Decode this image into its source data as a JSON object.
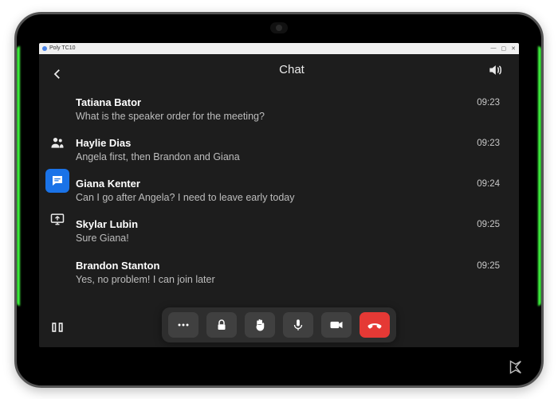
{
  "window": {
    "title": "Poly TC10"
  },
  "header": {
    "title": "Chat"
  },
  "sidebar": {
    "items": [
      {
        "name": "people-icon"
      },
      {
        "name": "chat-icon"
      },
      {
        "name": "share-screen-icon"
      }
    ],
    "bottom": {
      "name": "layout-icon"
    }
  },
  "messages": [
    {
      "name": "Tatiana Bator",
      "text": "What is the speaker order for the meeting?",
      "time": "09:23"
    },
    {
      "name": "Haylie Dias",
      "text": "Angela first, then Brandon and Giana",
      "time": "09:23"
    },
    {
      "name": "Giana Kenter",
      "text": "Can I go after Angela? I need to leave early today",
      "time": "09:24"
    },
    {
      "name": "Skylar Lubin",
      "text": "Sure Giana!",
      "time": "09:25"
    },
    {
      "name": "Brandon Stanton",
      "text": "Yes, no problem! I can join later",
      "time": "09:25"
    }
  ],
  "toolbar": {
    "buttons": [
      {
        "name": "more-icon"
      },
      {
        "name": "lock-icon"
      },
      {
        "name": "raise-hand-icon"
      },
      {
        "name": "mic-icon"
      },
      {
        "name": "camera-icon"
      },
      {
        "name": "end-call-icon"
      }
    ]
  }
}
